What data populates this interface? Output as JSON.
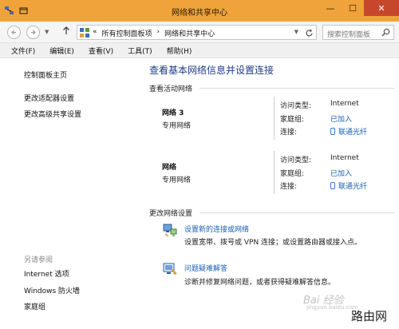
{
  "window": {
    "title": "网络和共享中心",
    "buttons": {
      "minimize": "—",
      "maximize": "☐",
      "close": "✕"
    }
  },
  "address": {
    "crumbs": [
      "«",
      "所有控制面板项",
      "›",
      "网络和共享中心"
    ],
    "search_placeholder": "搜索控制面板"
  },
  "menu": [
    "文件(F)",
    "编辑(E)",
    "查看(V)",
    "工具(T)",
    "帮助(H)"
  ],
  "sidebar": {
    "links": [
      "控制面板主页",
      "更改适配器设置",
      "更改高级共享设置"
    ],
    "see_also_heading": "另请参阅",
    "see_also": [
      "Internet 选项",
      "Windows 防火墙",
      "家庭组"
    ]
  },
  "main": {
    "title": "查看基本网络信息并设置连接",
    "active_heading": "查看活动网络",
    "networks": [
      {
        "name": "网络  3",
        "type": "专用网络",
        "access_label": "访问类型:",
        "access_value": "Internet",
        "homegroup_label": "家庭组:",
        "homegroup_value": "已加入",
        "connection_label": "连接:",
        "connection_value": "联通光纤"
      },
      {
        "name": "网络",
        "type": "专用网络",
        "access_label": "访问类型:",
        "access_value": "Internet",
        "homegroup_label": "家庭组:",
        "homegroup_value": "已加入",
        "connection_label": "连接:",
        "connection_value": "联通光纤"
      }
    ],
    "change_heading": "更改网络设置",
    "tasks": [
      {
        "link": "设置新的连接或网络",
        "desc": "设置宽带、拨号或 VPN 连接；或设置路由器或接入点。",
        "icon": "new-connection-icon"
      },
      {
        "link": "问题疑难解答",
        "desc": "诊断并修复网络问题，或者获得疑难解答信息。",
        "icon": "troubleshoot-icon"
      }
    ]
  },
  "watermark": {
    "baidu": "Bai 经验",
    "url": "jingyan.baidu.com",
    "brand": "路由网"
  },
  "colors": {
    "titlebar": "#f0a33b",
    "close": "#c7472d",
    "link": "#1a5fb4",
    "title": "#1f3b8a"
  }
}
